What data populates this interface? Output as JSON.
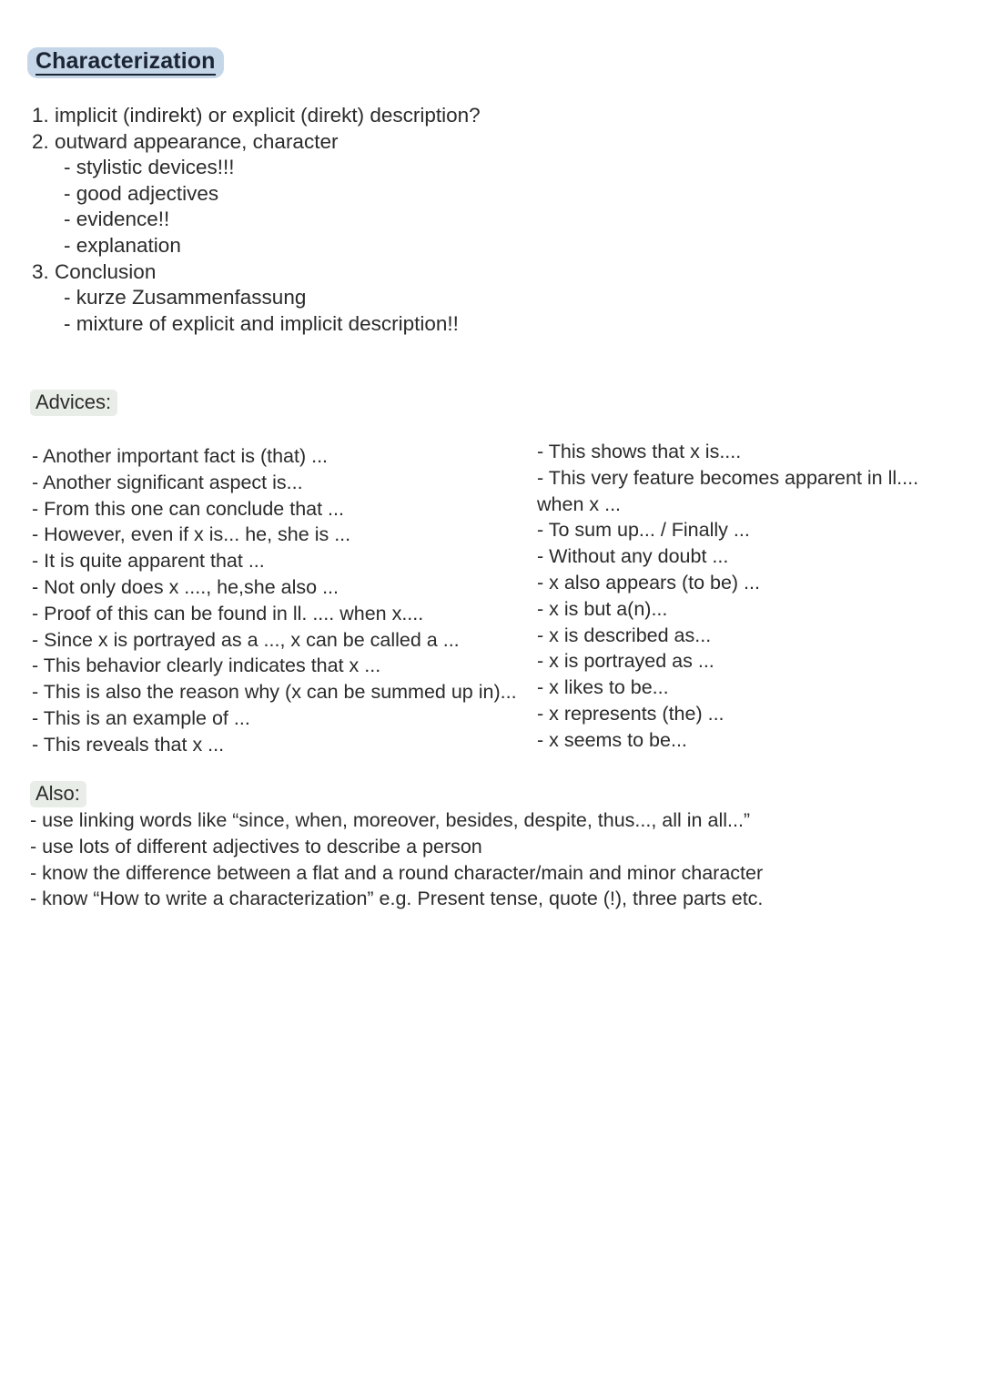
{
  "document": {
    "title": "Characterization",
    "title_highlight_color": "#c6d6e9",
    "title_text_color": "#1b2433",
    "body_text_color": "#2b2b2b",
    "heading_highlight_color": "#e9ede7",
    "background_color": "#ffffff"
  },
  "outline": {
    "lines": [
      "1. implicit (indirekt) or explicit (direkt) description?",
      "2. outward appearance, character",
      "- stylistic devices!!!",
      "- good adjectives",
      "- evidence!!",
      "- explanation",
      "3. Conclusion",
      "- kurze Zusammenfassung",
      "- mixture of explicit and implicit description!!"
    ],
    "indent_flags": [
      false,
      false,
      true,
      true,
      true,
      true,
      false,
      true,
      true
    ]
  },
  "advices": {
    "heading": "Advices:",
    "left_column": [
      "- Another important fact is (that) ...",
      "- Another significant aspect is...",
      "- From this one can conclude that ...",
      "- However, even if x is... he, she is ...",
      "- It is quite apparent that ...",
      "- Not only does x ...., he,she also ...",
      "- Proof of this can be found in ll. .... when x....",
      "- Since x is portrayed as a ..., x can be called a ...",
      "- This behavior clearly indicates that x ...",
      "- This is also the reason why (x can be summed up in)...",
      "- This is an example of ...",
      "- This reveals that x ..."
    ],
    "right_column": [
      "- This shows that x is....",
      "- This very feature becomes apparent in ll....",
      "when x ...",
      "- To sum up... / Finally ...",
      "- Without any doubt ...",
      "- x also appears (to be) ...",
      "- x is but a(n)...",
      "- x is described as...",
      "- x is portrayed as ...",
      "- x likes to be...",
      "- x represents (the) ...",
      "- x seems to be..."
    ]
  },
  "also": {
    "heading": "Also:",
    "lines": [
      "- use linking words like “since, when, moreover, besides, despite, thus..., all in all...”",
      "- use lots of different adjectives to describe a person",
      "- know the difference between a flat and a round character/main and minor character",
      "- know “How to write a characterization” e.g. Present tense, quote (!), three parts etc."
    ]
  }
}
